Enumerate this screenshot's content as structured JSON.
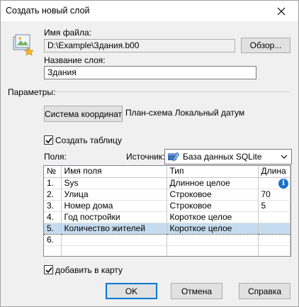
{
  "window": {
    "title": "Создать новый слой"
  },
  "file": {
    "label": "Имя файла:",
    "value": "D:\\Example\\Здания.b00",
    "browse_label": "Обзор..."
  },
  "layer": {
    "label": "Название слоя:",
    "value": "Здания"
  },
  "params": {
    "label": "Параметры:"
  },
  "coords": {
    "button_label": "Система координат",
    "value": "План-схема Локальный датум"
  },
  "create_table": {
    "label": "Создать таблицу",
    "checked": true
  },
  "fields": {
    "label": "Поля:"
  },
  "source": {
    "label": "Источник:",
    "value": "База данных SQLite"
  },
  "table": {
    "columns": [
      "№",
      "Имя поля",
      "Тип",
      "Длина"
    ],
    "rows": [
      {
        "n": "1.",
        "name": "Sys",
        "type": "Длинное целое",
        "len": ""
      },
      {
        "n": "2.",
        "name": "Улица",
        "type": "Строковое",
        "len": "70"
      },
      {
        "n": "3.",
        "name": "Номер дома",
        "type": "Строковое",
        "len": "5"
      },
      {
        "n": "4.",
        "name": "Год постройки",
        "type": "Короткое целое",
        "len": ""
      },
      {
        "n": "5.",
        "name": "Количество жителей",
        "type": "Короткое целое",
        "len": ""
      },
      {
        "n": "6.",
        "name": "",
        "type": "",
        "len": ""
      }
    ],
    "selected_row": 5,
    "info_icon": "i"
  },
  "add_to_map": {
    "label": "добавить в карту",
    "checked": true
  },
  "buttons": {
    "ok": "OK",
    "cancel": "Отмена",
    "help": "Справка"
  }
}
